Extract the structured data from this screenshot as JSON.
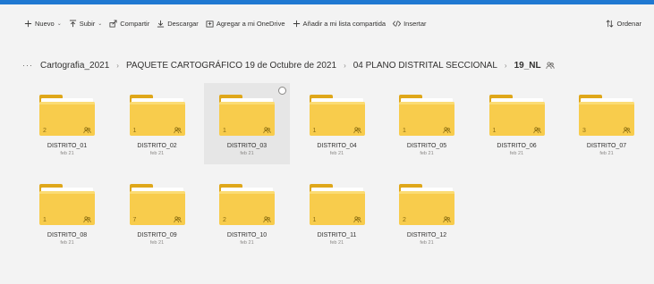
{
  "toolbar": {
    "new_label": "Nuevo",
    "upload_label": "Subir",
    "share_label": "Compartir",
    "download_label": "Descargar",
    "add_onedrive_label": "Agregar a mi OneDrive",
    "add_shared_list_label": "Añadir a mi lista compartida",
    "embed_label": "Insertar",
    "sort_label": "Ordenar"
  },
  "breadcrumb": {
    "more": "···",
    "items": [
      "Cartografia_2021",
      "PAQUETE CARTOGRÁFICO 19 de Octubre de 2021",
      "04 PLANO DISTRITAL SECCIONAL",
      "19_NL"
    ],
    "separator": "›"
  },
  "folders": [
    {
      "name": "DISTRITO_01",
      "date": "feb 21",
      "count": "2",
      "selected": false
    },
    {
      "name": "DISTRITO_02",
      "date": "feb 21",
      "count": "1",
      "selected": false
    },
    {
      "name": "DISTRITO_03",
      "date": "feb 21",
      "count": "1",
      "selected": true
    },
    {
      "name": "DISTRITO_04",
      "date": "feb 21",
      "count": "1",
      "selected": false
    },
    {
      "name": "DISTRITO_05",
      "date": "feb 21",
      "count": "1",
      "selected": false
    },
    {
      "name": "DISTRITO_06",
      "date": "feb 21",
      "count": "1",
      "selected": false
    },
    {
      "name": "DISTRITO_07",
      "date": "feb 21",
      "count": "3",
      "selected": false
    },
    {
      "name": "DISTRITO_08",
      "date": "feb 21",
      "count": "1",
      "selected": false
    },
    {
      "name": "DISTRITO_09",
      "date": "feb 21",
      "count": "7",
      "selected": false
    },
    {
      "name": "DISTRITO_10",
      "date": "feb 21",
      "count": "2",
      "selected": false
    },
    {
      "name": "DISTRITO_11",
      "date": "feb 21",
      "count": "1",
      "selected": false
    },
    {
      "name": "DISTRITO_12",
      "date": "feb 21",
      "count": "2",
      "selected": false
    }
  ],
  "colors": {
    "accent": "#1f78d1",
    "folder_front": "#f8cc4c",
    "folder_back": "#dfa71a",
    "selection": "#e6e6e6"
  }
}
